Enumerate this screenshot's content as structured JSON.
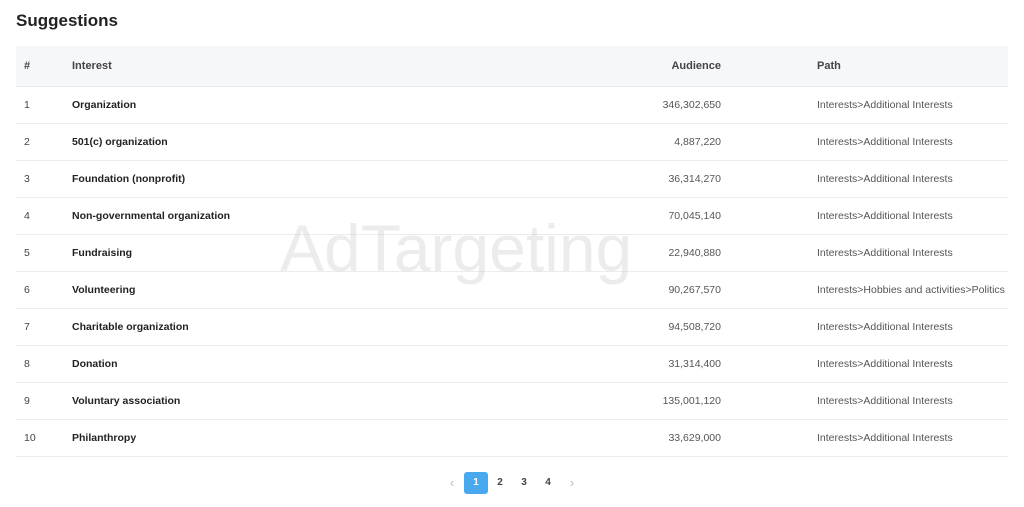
{
  "header": {
    "title": "Suggestions"
  },
  "watermark": "AdTargeting",
  "table": {
    "columns": {
      "idx": "#",
      "interest": "Interest",
      "audience": "Audience",
      "path": "Path"
    },
    "rows": [
      {
        "idx": "1",
        "interest": "Organization",
        "audience": "346,302,650",
        "path": "Interests>Additional Interests"
      },
      {
        "idx": "2",
        "interest": "501(c) organization",
        "audience": "4,887,220",
        "path": "Interests>Additional Interests"
      },
      {
        "idx": "3",
        "interest": "Foundation (nonprofit)",
        "audience": "36,314,270",
        "path": "Interests>Additional Interests"
      },
      {
        "idx": "4",
        "interest": "Non-governmental organization",
        "audience": "70,045,140",
        "path": "Interests>Additional Interests"
      },
      {
        "idx": "5",
        "interest": "Fundraising",
        "audience": "22,940,880",
        "path": "Interests>Additional Interests"
      },
      {
        "idx": "6",
        "interest": "Volunteering",
        "audience": "90,267,570",
        "path": "Interests>Hobbies and activities>Politics and social issues"
      },
      {
        "idx": "7",
        "interest": "Charitable organization",
        "audience": "94,508,720",
        "path": "Interests>Additional Interests"
      },
      {
        "idx": "8",
        "interest": "Donation",
        "audience": "31,314,400",
        "path": "Interests>Additional Interests"
      },
      {
        "idx": "9",
        "interest": "Voluntary association",
        "audience": "135,001,120",
        "path": "Interests>Additional Interests"
      },
      {
        "idx": "10",
        "interest": "Philanthropy",
        "audience": "33,629,000",
        "path": "Interests>Additional Interests"
      }
    ]
  },
  "pagination": {
    "prev_icon": "chevron-left-icon",
    "next_icon": "chevron-right-icon",
    "prev_glyph": "‹",
    "next_glyph": "›",
    "pages": [
      "1",
      "2",
      "3",
      "4"
    ],
    "current": "1",
    "accent_color": "#49a9ee"
  }
}
